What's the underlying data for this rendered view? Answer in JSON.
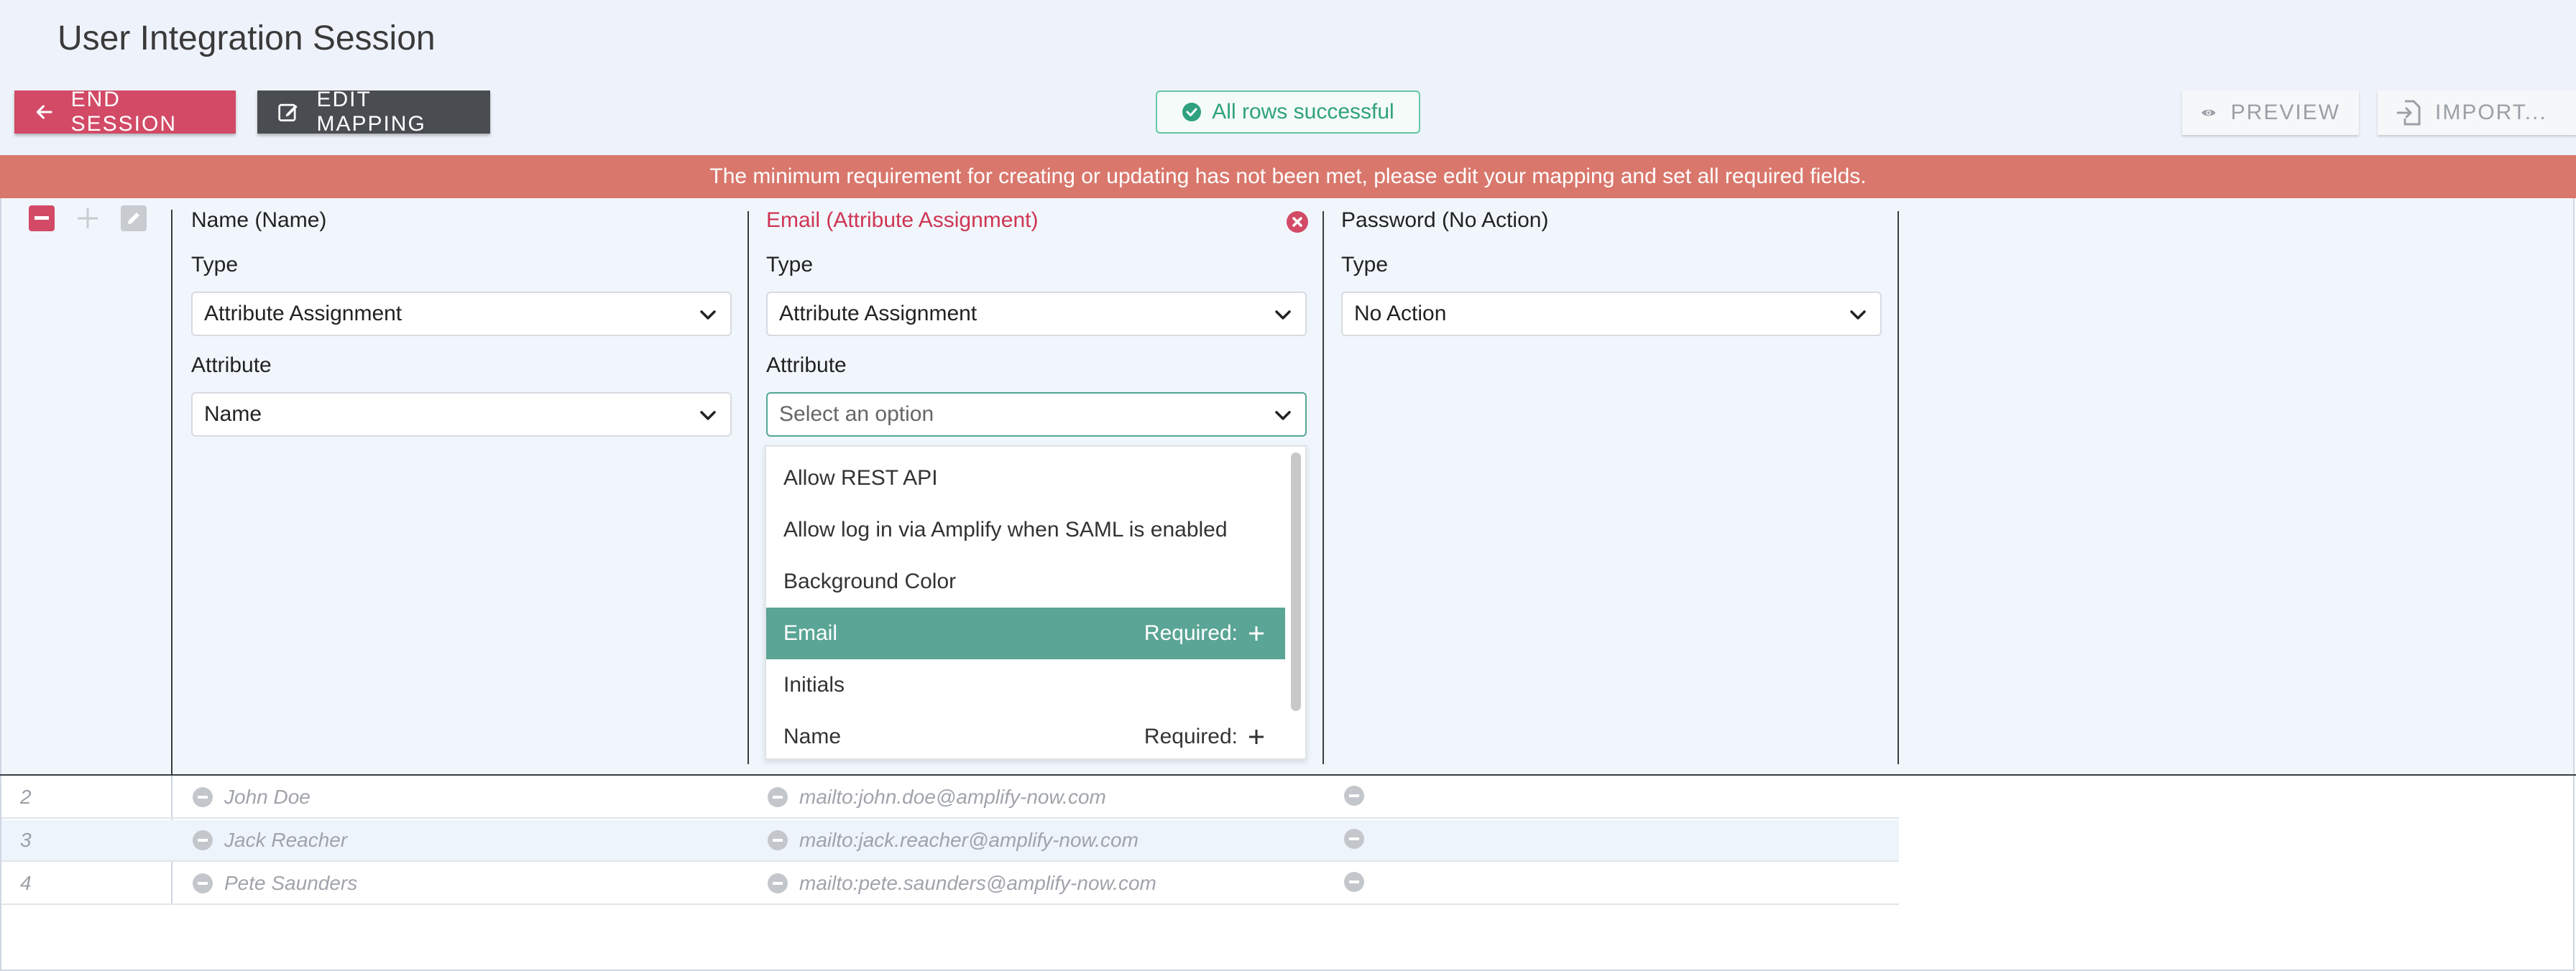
{
  "header": {
    "title": "User Integration Session",
    "end_session_label": "END SESSION",
    "edit_mapping_label": "EDIT MAPPING",
    "status_text": "All rows successful",
    "preview_label": "PREVIEW",
    "import_label": "IMPORT..."
  },
  "banner": {
    "message": "The minimum requirement for creating or updating has not been met, please edit your mapping and set all required fields."
  },
  "mapping": {
    "columns": [
      {
        "header": "Name (Name)",
        "type_label": "Type",
        "type_value": "Attribute Assignment",
        "attribute_label": "Attribute",
        "attribute_value": "Name"
      },
      {
        "header": "Email (Attribute Assignment)",
        "type_label": "Type",
        "type_value": "Attribute Assignment",
        "attribute_label": "Attribute",
        "attribute_placeholder": "Select an option"
      },
      {
        "header": "Password (No Action)",
        "type_label": "Type",
        "type_value": "No Action"
      }
    ],
    "dropdown_options": [
      {
        "label": "Allow REST API",
        "required": ""
      },
      {
        "label": "Allow log in via Amplify when SAML is enabled",
        "required": ""
      },
      {
        "label": "Background Color",
        "required": ""
      },
      {
        "label": "Email",
        "required": "Required:"
      },
      {
        "label": "Initials",
        "required": ""
      },
      {
        "label": "Name",
        "required": "Required:"
      }
    ]
  },
  "rows": [
    {
      "num": "2",
      "name": "John Doe",
      "email": "mailto:john.doe@amplify-now.com"
    },
    {
      "num": "3",
      "name": "Jack Reacher",
      "email": "mailto:jack.reacher@amplify-now.com"
    },
    {
      "num": "4",
      "name": "Pete Saunders",
      "email": "mailto:pete.saunders@amplify-now.com"
    }
  ],
  "colors": {
    "danger": "#d24a66",
    "dark": "#494d52",
    "success": "#2fa17d",
    "banner": "#d9776c",
    "highlight": "#5aa595"
  },
  "icons": [
    "arrow-left-icon",
    "edit-icon",
    "check-circle-icon",
    "eye-icon",
    "import-icon",
    "minus-square-icon",
    "plus-icon",
    "pencil-icon",
    "close-circle-icon",
    "chevron-down-icon",
    "minus-circle-icon"
  ]
}
